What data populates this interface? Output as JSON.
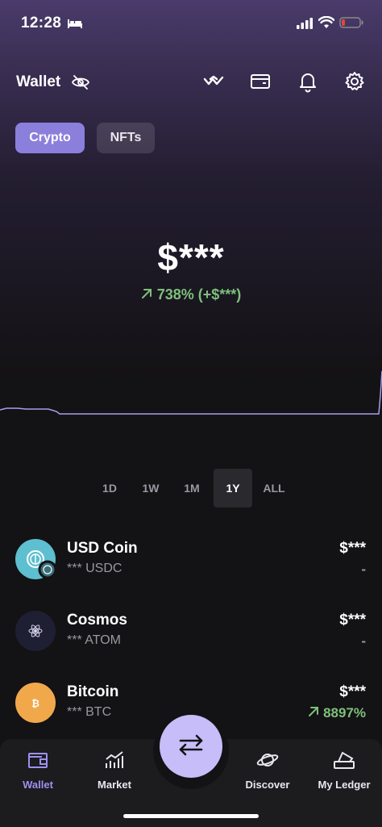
{
  "status": {
    "time": "12:28"
  },
  "header": {
    "title": "Wallet"
  },
  "tabs": [
    {
      "label": "Crypto"
    },
    {
      "label": "NFTs"
    }
  ],
  "balance": {
    "amount": "$***",
    "change_pct": "738%",
    "change_amt": "(+$***)"
  },
  "ranges": [
    "1D",
    "1W",
    "1M",
    "1Y",
    "ALL"
  ],
  "selected_range": "1Y",
  "assets": [
    {
      "name": "USD Coin",
      "sub": "*** USDC",
      "value": "$***",
      "change": "-",
      "logo_color": "#5dbfcf"
    },
    {
      "name": "Cosmos",
      "sub": "*** ATOM",
      "value": "$***",
      "change": "-",
      "logo_color": "#1f1f33"
    },
    {
      "name": "Bitcoin",
      "sub": "*** BTC",
      "value": "$***",
      "change": "8897%",
      "logo_color": "#f1a84b"
    }
  ],
  "nav": {
    "wallet": "Wallet",
    "market": "Market",
    "discover": "Discover",
    "ledger": "My Ledger"
  },
  "colors": {
    "accent": "#8b7fdc",
    "positive": "#7ec07b",
    "fab": "#c7bdf9"
  }
}
